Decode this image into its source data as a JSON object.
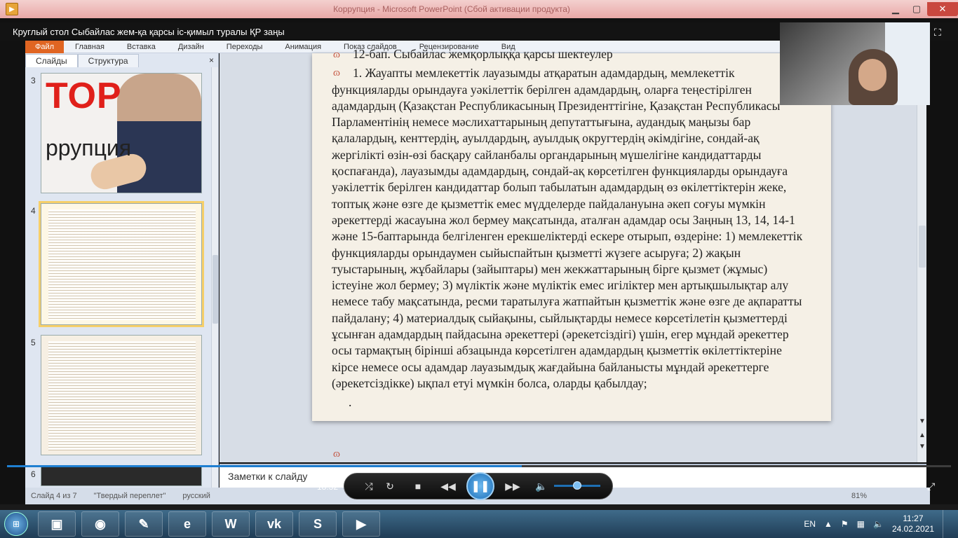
{
  "window": {
    "title": "Коррупция - Microsoft PowerPoint (Сбой активации продукта)"
  },
  "video": {
    "title": "Круглый стол Сыбайлас жем-қа қарсы іс-қимыл туралы ҚР заңы",
    "elapsed": "18:32",
    "progress_fraction": 0.545,
    "volume_fraction": 0.5
  },
  "ribbon": {
    "tabs": [
      "Файл",
      "Главная",
      "Вставка",
      "Дизайн",
      "Переходы",
      "Анимация",
      "Показ слайдов",
      "Рецензирование",
      "Вид"
    ]
  },
  "sidepanel": {
    "tabs": [
      "Слайды",
      "Структура"
    ],
    "close": "×",
    "thumbnails": [
      {
        "num": "3",
        "title": "ТОР",
        "subtitle": "ррупция"
      },
      {
        "num": "4"
      },
      {
        "num": "5"
      },
      {
        "num": "6"
      }
    ]
  },
  "slide": {
    "heading": "12-бап. Сыбайлас жемқорлыққа қарсы шектеулер",
    "body": "1. Жауапты мемлекеттік лауазымды атқаратын адамдардың, мемлекеттік функцияларды орындауға уәкілеттік берілген адамдардың, оларға теңестірілген адамдардың (Қазақстан Республикасының Президенттігіне, Қазақстан Республикасы Парламентінің немесе мәслихаттарының депутаттығына, аудандық маңызы бар қалалардың, кенттердің, ауылдардың, ауылдық округтердің әкімдігіне, сондай-ақ жергілікті өзін-өзі басқару сайланбалы органдарының мүшелігіне кандидаттарды қоспағанда), лауазымды адамдардың, сондай-ақ көрсетілген функцияларды орындауға уәкілеттік берілген кандидаттар болып табылатын адамдардың өз өкілеттіктерін жеке, топтық және өзге де қызметтік емес мүдделерде пайдалануына әкеп соғуы мүмкін әрекеттерді жасауына жол бермеу мақсатында, аталған адамдар осы Заңның 13, 14, 14-1 және 15-баптарында белгіленген ерекшеліктерді ескере отырып, өздеріне:     1) мемлекеттік функцияларды орындаумен сыйыспайтын қызметті жүзеге асыруға;     2) жақын туыстарының, жұбайлары (зайыптары) мен жекжаттарының бірге қызмет (жұмыс) істеуіне жол бермеу;     3) мүліктік және мүліктік емес игіліктер мен артықшылықтар алу немесе табу мақсатында, ресми таратылуға жатпайтын қызметтік және өзге де ақпаратты пайдалану;     4) материалдық сыйақыны, сыйлықтарды немесе көрсетілетін қызметтерді ұсынған адамдардың пайдасына әрекеттері (әрекетсіздігі) үшін, егер мұндай әрекеттер осы тармақтың бірінші абзацында көрсетілген адамдардың қызметтік өкілеттіктеріне кірсе немесе осы адамдар лауазымдық жағдайына байланысты мұндай әрекеттерге (әрекетсіздікке) ықпал етуі мүмкін болса, оларды қабылдау;",
    "bullet_glyph": "ɷ",
    "tail": "."
  },
  "notes": {
    "label": "Заметки к слайду"
  },
  "statusbar": {
    "slide": "Слайд 4 из 7",
    "theme": "\"Твердый переплет\"",
    "lang": "русский",
    "zoom": "81%"
  },
  "taskbar": {
    "apps": [
      {
        "name": "explorer",
        "glyph": "▣"
      },
      {
        "name": "chrome",
        "glyph": "◉"
      },
      {
        "name": "paint",
        "glyph": "✎"
      },
      {
        "name": "edge",
        "glyph": "e"
      },
      {
        "name": "word",
        "glyph": "W"
      },
      {
        "name": "vk",
        "glyph": "vk"
      },
      {
        "name": "skype",
        "glyph": "S"
      },
      {
        "name": "player",
        "glyph": "▶"
      }
    ],
    "lang": "EN",
    "time": "11:27",
    "date": "24.02.2021"
  }
}
